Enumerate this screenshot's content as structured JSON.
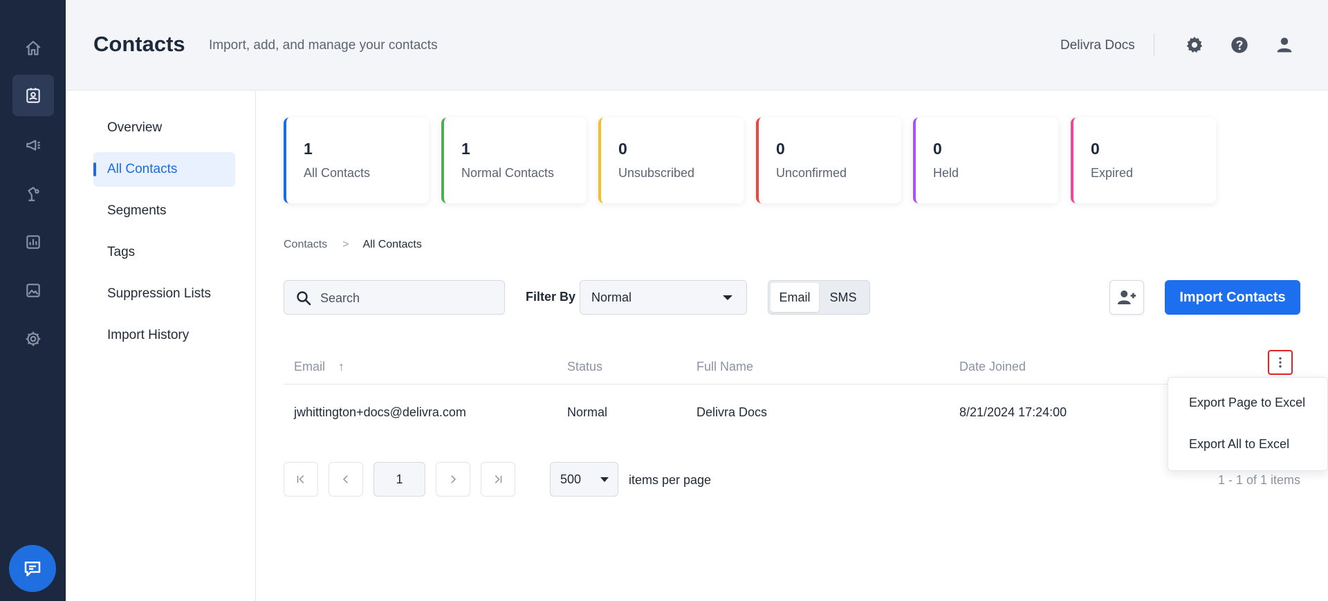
{
  "header": {
    "title": "Contacts",
    "subtitle": "Import, add, and manage your contacts",
    "account_name": "Delivra Docs"
  },
  "rail": {
    "items": [
      "home-icon",
      "contacts-icon",
      "campaigns-icon",
      "automation-icon",
      "reports-icon",
      "images-icon",
      "settings-icon"
    ],
    "active": "contacts-icon",
    "chat": "chat-icon"
  },
  "subnav": {
    "items": [
      {
        "label": "Overview"
      },
      {
        "label": "All Contacts",
        "active": true
      },
      {
        "label": "Segments"
      },
      {
        "label": "Tags"
      },
      {
        "label": "Suppression Lists"
      },
      {
        "label": "Import History"
      }
    ]
  },
  "stats": [
    {
      "value": "1",
      "label": "All Contacts",
      "color": "#1d6ae5"
    },
    {
      "value": "1",
      "label": "Normal Contacts",
      "color": "#4caf50"
    },
    {
      "value": "0",
      "label": "Unsubscribed",
      "color": "#fbbf24"
    },
    {
      "value": "0",
      "label": "Unconfirmed",
      "color": "#ef4444"
    },
    {
      "value": "0",
      "label": "Held",
      "color": "#a855f7"
    },
    {
      "value": "0",
      "label": "Expired",
      "color": "#ec4899"
    }
  ],
  "breadcrumb": {
    "root": "Contacts",
    "separator": ">",
    "current": "All Contacts"
  },
  "toolbar": {
    "search_placeholder": "Search",
    "filter_label": "Filter By",
    "filter_value": "Normal",
    "channels": [
      "Email",
      "SMS"
    ],
    "active_channel": "Email",
    "import_label": "Import Contacts"
  },
  "table": {
    "columns": [
      "Email",
      "Status",
      "Full Name",
      "Date Joined"
    ],
    "sort_indicator": "↑",
    "rows": [
      {
        "email": "jwhittington+docs@delivra.com",
        "status": "Normal",
        "full_name": "Delivra Docs",
        "date_joined": "8/21/2024 17:24:00"
      }
    ]
  },
  "menu": {
    "items": [
      "Export Page to Excel",
      "Export All to Excel"
    ]
  },
  "pagination": {
    "current_page": "1",
    "per_page": "500",
    "per_page_label": "items per page",
    "summary": "1 - 1 of 1 items"
  },
  "colors": {
    "primary": "#1d6ff0",
    "rail_bg": "#1c2840",
    "highlight_border": "#e02424"
  }
}
